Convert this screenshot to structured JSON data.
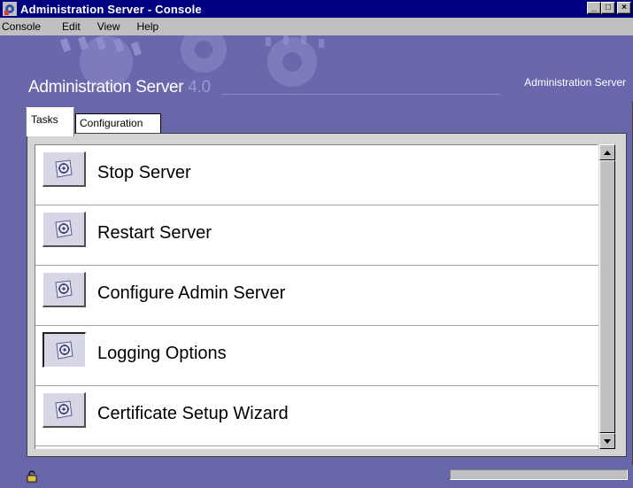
{
  "window": {
    "title": "Administration Server - Console",
    "minimize": "_",
    "maximize": "□",
    "close": "×"
  },
  "menu": [
    "Console",
    "Edit",
    "View",
    "Help"
  ],
  "banner": {
    "title": "Administration Server",
    "version": " 4.0",
    "right_label": "Administration Server"
  },
  "tabs": {
    "active": "Tasks",
    "inactive": "Configuration"
  },
  "tasks": [
    {
      "label": "Stop Server",
      "icon": "task-icon"
    },
    {
      "label": "Restart Server",
      "icon": "task-icon"
    },
    {
      "label": "Configure Admin Server",
      "icon": "task-icon"
    },
    {
      "label": "Logging Options",
      "icon": "task-icon"
    },
    {
      "label": "Certificate Setup Wizard",
      "icon": "task-icon"
    }
  ],
  "status": {
    "progress": 0
  }
}
